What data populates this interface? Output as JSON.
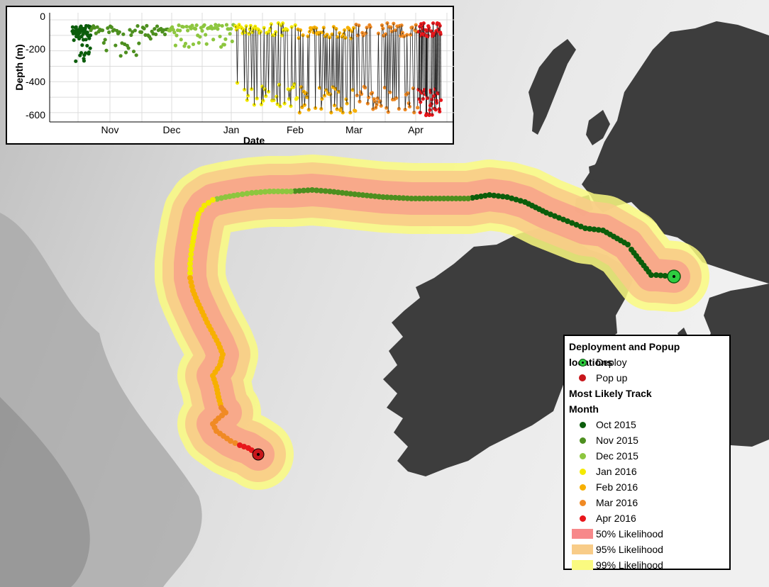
{
  "inset": {
    "ylabel": "Depth (m)",
    "xlabel": "Date",
    "yticks": [
      "0",
      "-200",
      "-400",
      "-600"
    ],
    "xticks": [
      "Nov",
      "Dec",
      "Jan",
      "Feb",
      "Mar",
      "Apr"
    ]
  },
  "chart_data": {
    "type": "scatter",
    "xlabel": "Date",
    "ylabel": "Depth (m)",
    "ylim": [
      -650,
      0
    ],
    "grid": true,
    "series": [
      {
        "month": "Oct 2015",
        "color": "#0b5d0b",
        "x": [
          "2015-10-20",
          "2015-10-25",
          "2015-10-30"
        ],
        "depth_range": [
          -280,
          -20
        ]
      },
      {
        "month": "Nov 2015",
        "color": "#4d8f1f",
        "x": [
          "2015-11-01",
          "2015-11-15",
          "2015-11-30"
        ],
        "depth_range": [
          -250,
          -20
        ]
      },
      {
        "month": "Dec 2015",
        "color": "#8dc63f",
        "x": [
          "2015-12-01",
          "2015-12-15",
          "2015-12-31"
        ],
        "depth_range": [
          -180,
          -20
        ]
      },
      {
        "month": "Jan 2016",
        "color": "#f4ea00",
        "x": [
          "2016-01-01",
          "2016-01-15",
          "2016-01-31"
        ],
        "depth_range": [
          -560,
          -20
        ]
      },
      {
        "month": "Feb 2016",
        "color": "#f7b000",
        "x": [
          "2016-02-01",
          "2016-02-15",
          "2016-02-29"
        ],
        "depth_range": [
          -600,
          -40
        ]
      },
      {
        "month": "Mar 2016",
        "color": "#f08a24",
        "x": [
          "2016-03-01",
          "2016-03-15",
          "2016-03-31"
        ],
        "depth_range": [
          -600,
          -20
        ]
      },
      {
        "month": "Apr 2016",
        "color": "#e8161b",
        "x": [
          "2016-04-01",
          "2016-04-05",
          "2016-04-10"
        ],
        "depth_range": [
          -620,
          -20
        ]
      }
    ]
  },
  "legend": {
    "title1": "Deployment and Popup locations",
    "deploy": "Deploy",
    "popup": "Pop up",
    "title2": "Most Likely Track",
    "title3": "Month",
    "months": [
      {
        "label": "Oct 2015",
        "color": "#0b5d0b"
      },
      {
        "label": "Nov 2015",
        "color": "#4d8f1f"
      },
      {
        "label": "Dec 2015",
        "color": "#8dc63f"
      },
      {
        "label": "Jan 2016",
        "color": "#f4ea00"
      },
      {
        "label": "Feb 2016",
        "color": "#f7b000"
      },
      {
        "label": "Mar 2016",
        "color": "#f08a24"
      },
      {
        "label": "Apr 2016",
        "color": "#e8161b"
      }
    ],
    "likelihood": [
      {
        "label": "50% Likelihood",
        "color": "#f7888a"
      },
      {
        "label": "95% Likelihood",
        "color": "#f8cc88"
      },
      {
        "label": "99% Likelihood",
        "color": "#fafa80"
      }
    ]
  },
  "colors": {
    "deploy": "#2ecc40",
    "popup": "#c8161b",
    "land": "#3d3d3d"
  }
}
